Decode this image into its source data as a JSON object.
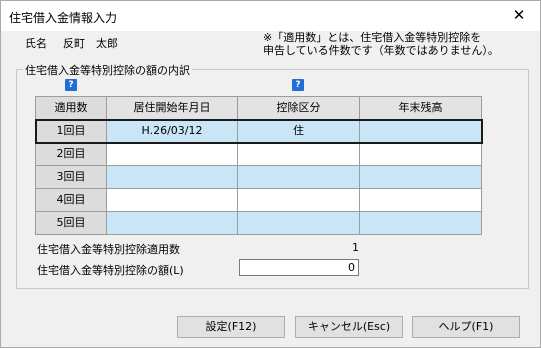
{
  "window": {
    "title": "住宅借入金情報入力",
    "close_glyph": "✕"
  },
  "person": {
    "label": "氏名",
    "name": "反町　太郎"
  },
  "note": {
    "line1": "※「適用数」とは、住宅借入金等特別控除を",
    "line2": "申告している件数です（年数ではありません）。"
  },
  "group": {
    "label": "住宅借入金等特別控除の額の内訳"
  },
  "help_icon": "?",
  "table": {
    "headers": [
      "適用数",
      "居住開始年月日",
      "控除区分",
      "年末残高"
    ],
    "rows": [
      {
        "label": "1回目",
        "start_date": "H.26/03/12",
        "category": "住",
        "balance": ""
      },
      {
        "label": "2回目",
        "start_date": "",
        "category": "",
        "balance": ""
      },
      {
        "label": "3回目",
        "start_date": "",
        "category": "",
        "balance": ""
      },
      {
        "label": "4回目",
        "start_date": "",
        "category": "",
        "balance": ""
      },
      {
        "label": "5回目",
        "start_date": "",
        "category": "",
        "balance": ""
      }
    ]
  },
  "summary": {
    "count_label": "住宅借入金等特別控除適用数",
    "count_value": "1",
    "amount_label": "住宅借入金等特別控除の額(L)",
    "amount_value": "0"
  },
  "buttons": {
    "set": "設定(F12)",
    "cancel": "キャンセル(Esc)",
    "help": "ヘルプ(F1)"
  }
}
